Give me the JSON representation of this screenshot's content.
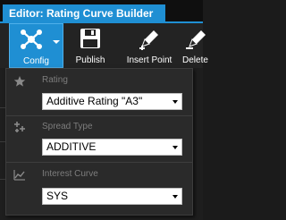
{
  "window": {
    "title": "Editor: Rating Curve Builder"
  },
  "toolbar": {
    "config_label": "Config",
    "publish_label": "Publish",
    "insert_point_label": "Insert Point",
    "delete_label": "Delete"
  },
  "config_menu": {
    "rating": {
      "label": "Rating",
      "selected": "Additive Rating \"A3\"",
      "icon": "star-icon"
    },
    "spread_type": {
      "label": "Spread Type",
      "selected": "ADDITIVE",
      "icon": "plus-cluster-icon"
    },
    "interest_curve": {
      "label": "Interest Curve",
      "selected": "SYS",
      "icon": "line-chart-icon"
    }
  },
  "colors": {
    "accent": "#1f8fd3",
    "background": "#151515",
    "panel": "#2a2a2a"
  }
}
